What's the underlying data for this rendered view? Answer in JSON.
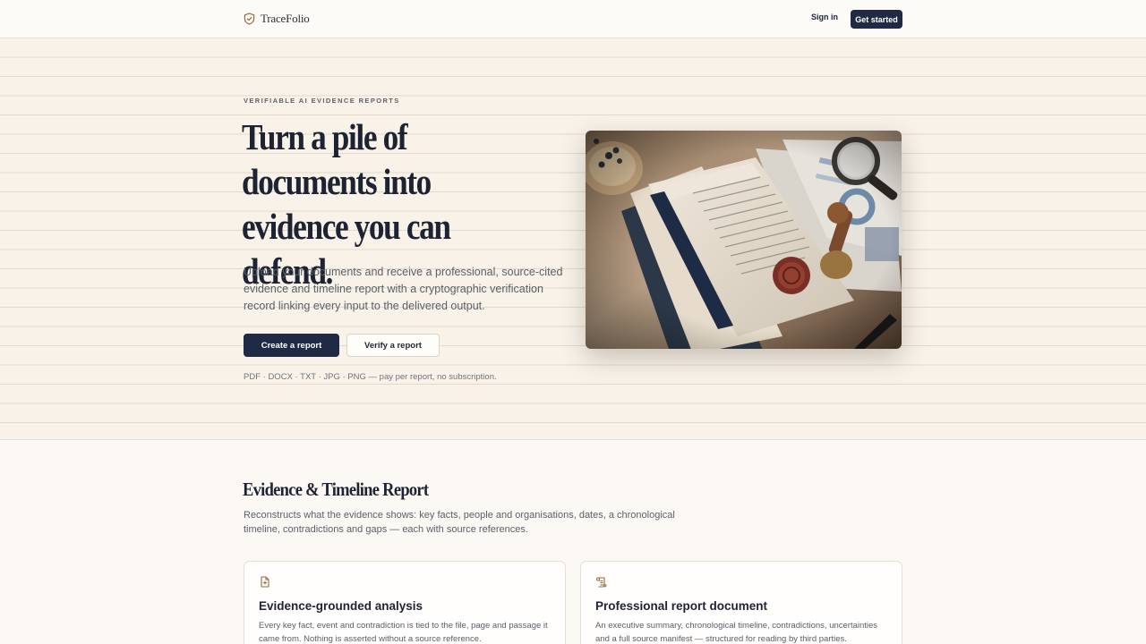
{
  "header": {
    "brand": "TraceFolio",
    "sign_in": "Sign in",
    "get_started": "Get started"
  },
  "hero": {
    "eyebrow": "VERIFIABLE AI EVIDENCE REPORTS",
    "headline": "Turn a pile of documents into evidence you can defend.",
    "copy": "Upload your documents and receive a professional, source-cited evidence and timeline report with a cryptographic verification record linking every input to the delivered output.",
    "primary_cta": "Create a report",
    "secondary_cta": "Verify a report",
    "formats": "PDF · DOCX · TXT · JPG · PNG — pay per report, no subscription."
  },
  "section": {
    "title": "Evidence & Timeline Report",
    "copy": "Reconstructs what the evidence shows: key facts, people and organisations, dates, a chronological timeline, contradictions and gaps — each with source references."
  },
  "cards": [
    {
      "icon": "document-icon",
      "title": "Evidence-grounded analysis",
      "copy": "Every key fact, event and contradiction is tied to the file, page and passage it came from. Nothing is asserted without a source reference."
    },
    {
      "icon": "scroll-icon",
      "title": "Professional report document",
      "copy": "An executive summary, chronological timeline, contradictions, uncertainties and a full source manifest — structured for reading by third parties."
    }
  ],
  "colors": {
    "navy": "#1f2a44",
    "accent_brown": "#9a6a3c",
    "hero_bg": "#f8f2e9",
    "page_bg": "#fcf9f4"
  }
}
